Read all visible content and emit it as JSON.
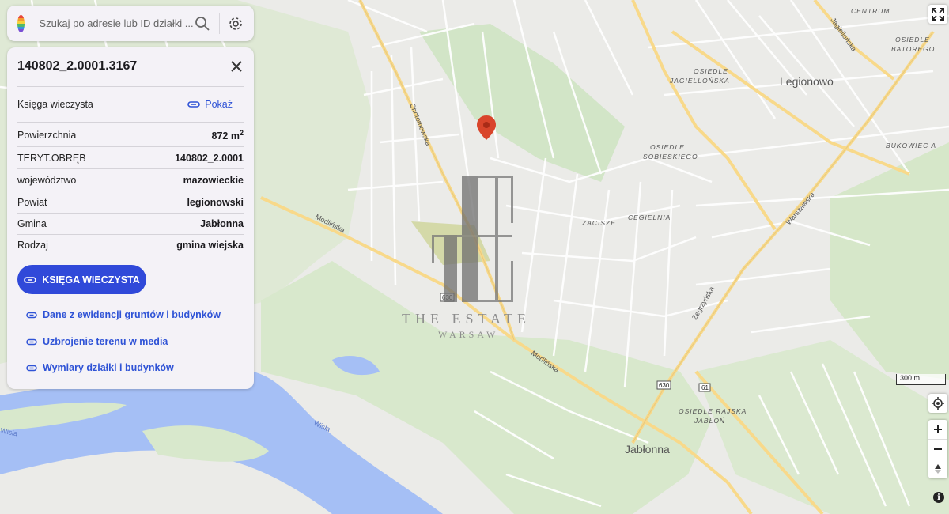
{
  "search": {
    "placeholder": "Szukaj po adresie lub ID działki ..."
  },
  "panel": {
    "title": "140802_2.0001.3167",
    "ksiega": {
      "label": "Księga wieczysta",
      "link": "Pokaż"
    },
    "rows": [
      {
        "label": "Powierzchnia",
        "value": "872 m",
        "sup": "2"
      },
      {
        "label": "TERYT.OBRĘB",
        "value": "140802_2.0001"
      },
      {
        "label": "województwo",
        "value": "mazowieckie"
      },
      {
        "label": "Powiat",
        "value": "legionowski"
      },
      {
        "label": "Gmina",
        "value": "Jabłonna"
      },
      {
        "label": "Rodzaj",
        "value": "gmina wiejska"
      }
    ],
    "button": "KSIĘGA WIECZYSTA",
    "links": [
      "Dane z ewidencji gruntów i budynków",
      "Uzbrojenie terenu w media",
      "Wymiary działki i budynków"
    ]
  },
  "map": {
    "places": {
      "centrum": "CENTRUM",
      "batorego1": "OSIEDLE",
      "batorego2": "BATOREGO",
      "jag1": "OSIEDLE",
      "jag2": "JAGIELLOŃSKA",
      "legionowo": "Legionowo",
      "sob1": "OSIEDLE",
      "sob2": "SOBIESKIEGO",
      "bukowiec": "BUKOWIEC A",
      "zacisze": "ZACISZE",
      "cegielnia": "CEGIELNIA",
      "rajska1": "OSIEDLE RAJSKA",
      "rajska2": "JABŁOŃ",
      "jablonna": "Jabłonna"
    },
    "streets": {
      "chotomowska": "Chotomowska",
      "modlinska1": "Modlińska",
      "modlinska2": "Modlińska",
      "warszawska": "Warszawska",
      "zegrzynska": "Zegrzyńska",
      "jagiellonska": "Jagiellońska",
      "wisla1": "Wisła",
      "wisla2": "Wisła"
    },
    "road_numbers": {
      "r630a": "630",
      "r630b": "630",
      "r61": "61"
    },
    "scale": "300 m",
    "watermark": {
      "line1": "THE ESTATE",
      "line2": "WARSAW"
    }
  },
  "colors": {
    "accent": "#3049d9",
    "link": "#2f53d6",
    "pin": "#d9452b",
    "river": "#a5bff5",
    "road": "#f8d98a"
  }
}
